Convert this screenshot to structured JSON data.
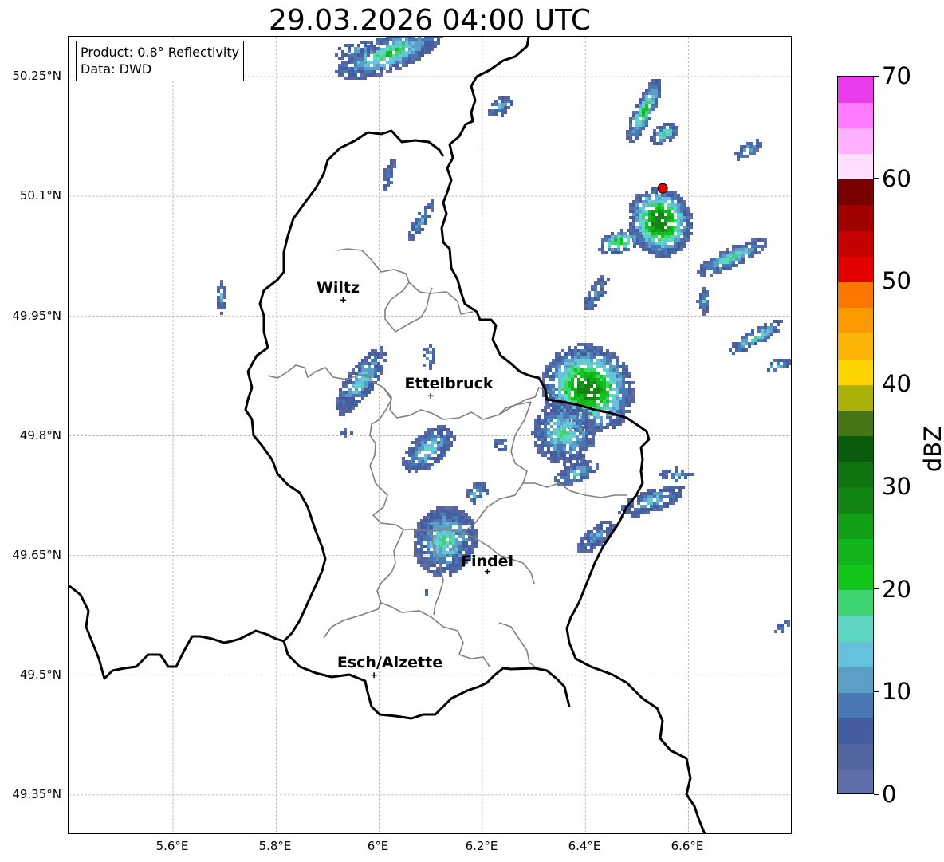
{
  "title": "29.03.2026 04:00 UTC",
  "info_box": {
    "product": "Product: 0.8° Reflectivity",
    "data": "Data: DWD"
  },
  "axes": {
    "lat_ticks": [
      "50.25°N",
      "50.1°N",
      "49.95°N",
      "49.8°N",
      "49.65°N",
      "49.5°N",
      "49.35°N"
    ],
    "lon_ticks": [
      "5.6°E",
      "5.8°E",
      "6°E",
      "6.2°E",
      "6.4°E",
      "6.6°E"
    ],
    "grid": true
  },
  "cities": [
    {
      "name": "Wiltz",
      "lon": 5.93,
      "lat": 49.97
    },
    {
      "name": "Ettelbruck",
      "lon": 6.1,
      "lat": 49.85
    },
    {
      "name": "Findel",
      "lon": 6.21,
      "lat": 49.63
    },
    {
      "name": "Esch/Alzette",
      "lon": 5.99,
      "lat": 49.5
    }
  ],
  "radar_site": {
    "color": "#e00000",
    "lon": 6.55,
    "lat": 50.11
  },
  "colorbar": {
    "unit": "dBZ",
    "min": 0,
    "max": 70,
    "tick_labels": [
      "0",
      "10",
      "20",
      "30",
      "40",
      "50",
      "60",
      "70"
    ],
    "colors": [
      "#5f6ea8",
      "#52659f",
      "#435da0",
      "#4a78b5",
      "#5b9ec6",
      "#66c2dc",
      "#5fd6c2",
      "#3fd472",
      "#12c51a",
      "#11b51b",
      "#129f15",
      "#128513",
      "#0f7410",
      "#095c0b",
      "#457514",
      "#abb108",
      "#fcd500",
      "#fcb406",
      "#fb9900",
      "#fc7700",
      "#e20202",
      "#c30101",
      "#a10000",
      "#7a0000",
      "#ffe1ff",
      "#ffb0ff",
      "#ff7bff",
      "#ea3cec"
    ]
  }
}
